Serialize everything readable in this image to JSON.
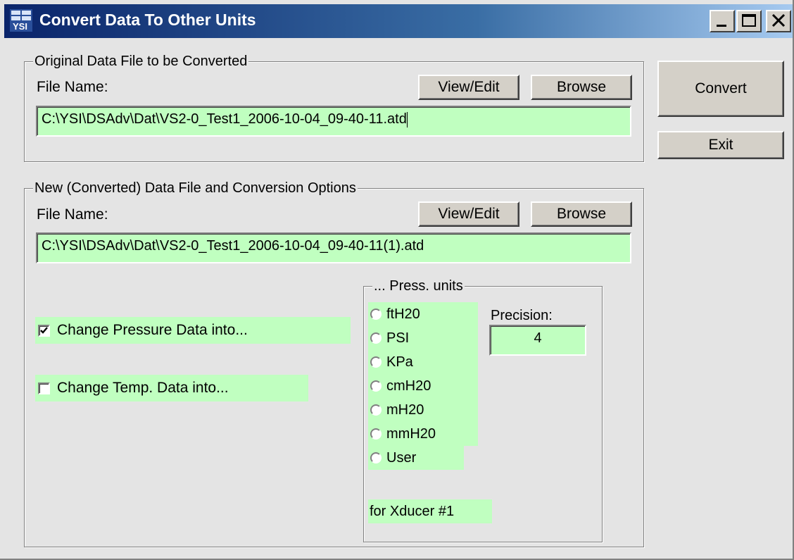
{
  "window": {
    "title": "Convert Data To Other Units",
    "icon": "ysi-app-icon",
    "controls": {
      "minimize": "_",
      "maximize": "□",
      "close": "X"
    }
  },
  "actions": {
    "convert_label": "Convert",
    "exit_label": "Exit"
  },
  "original": {
    "group_label": "Original Data File to be Converted",
    "file_name_label": "File Name:",
    "view_edit_label": "View/Edit",
    "browse_label": "Browse",
    "file_path": "C:\\YSI\\DSAdv\\Dat\\VS2-0_Test1_2006-10-04_09-40-11.atd"
  },
  "converted": {
    "group_label": "New (Converted) Data File and Conversion Options",
    "file_name_label": "File Name:",
    "view_edit_label": "View/Edit",
    "browse_label": "Browse",
    "file_path": "C:\\YSI\\DSAdv\\Dat\\VS2-0_Test1_2006-10-04_09-40-11(1).atd",
    "change_pressure": {
      "label": "Change Pressure Data into...",
      "checked": true
    },
    "change_temp": {
      "label": "Change Temp. Data into...",
      "checked": false
    }
  },
  "press_units": {
    "group_label": "... Press. units",
    "options": [
      "ftH20",
      "PSI",
      "KPa",
      "cmH20",
      "mH20",
      "mmH20",
      "User"
    ],
    "selected": null,
    "precision_label": "Precision:",
    "precision_value": "4",
    "xducer_label": "for Xducer #1"
  },
  "colors": {
    "field_bg": "#c0ffc0",
    "window_bg": "#e4e4e4",
    "title_start": "#0a246a",
    "title_end": "#a6caf0"
  }
}
